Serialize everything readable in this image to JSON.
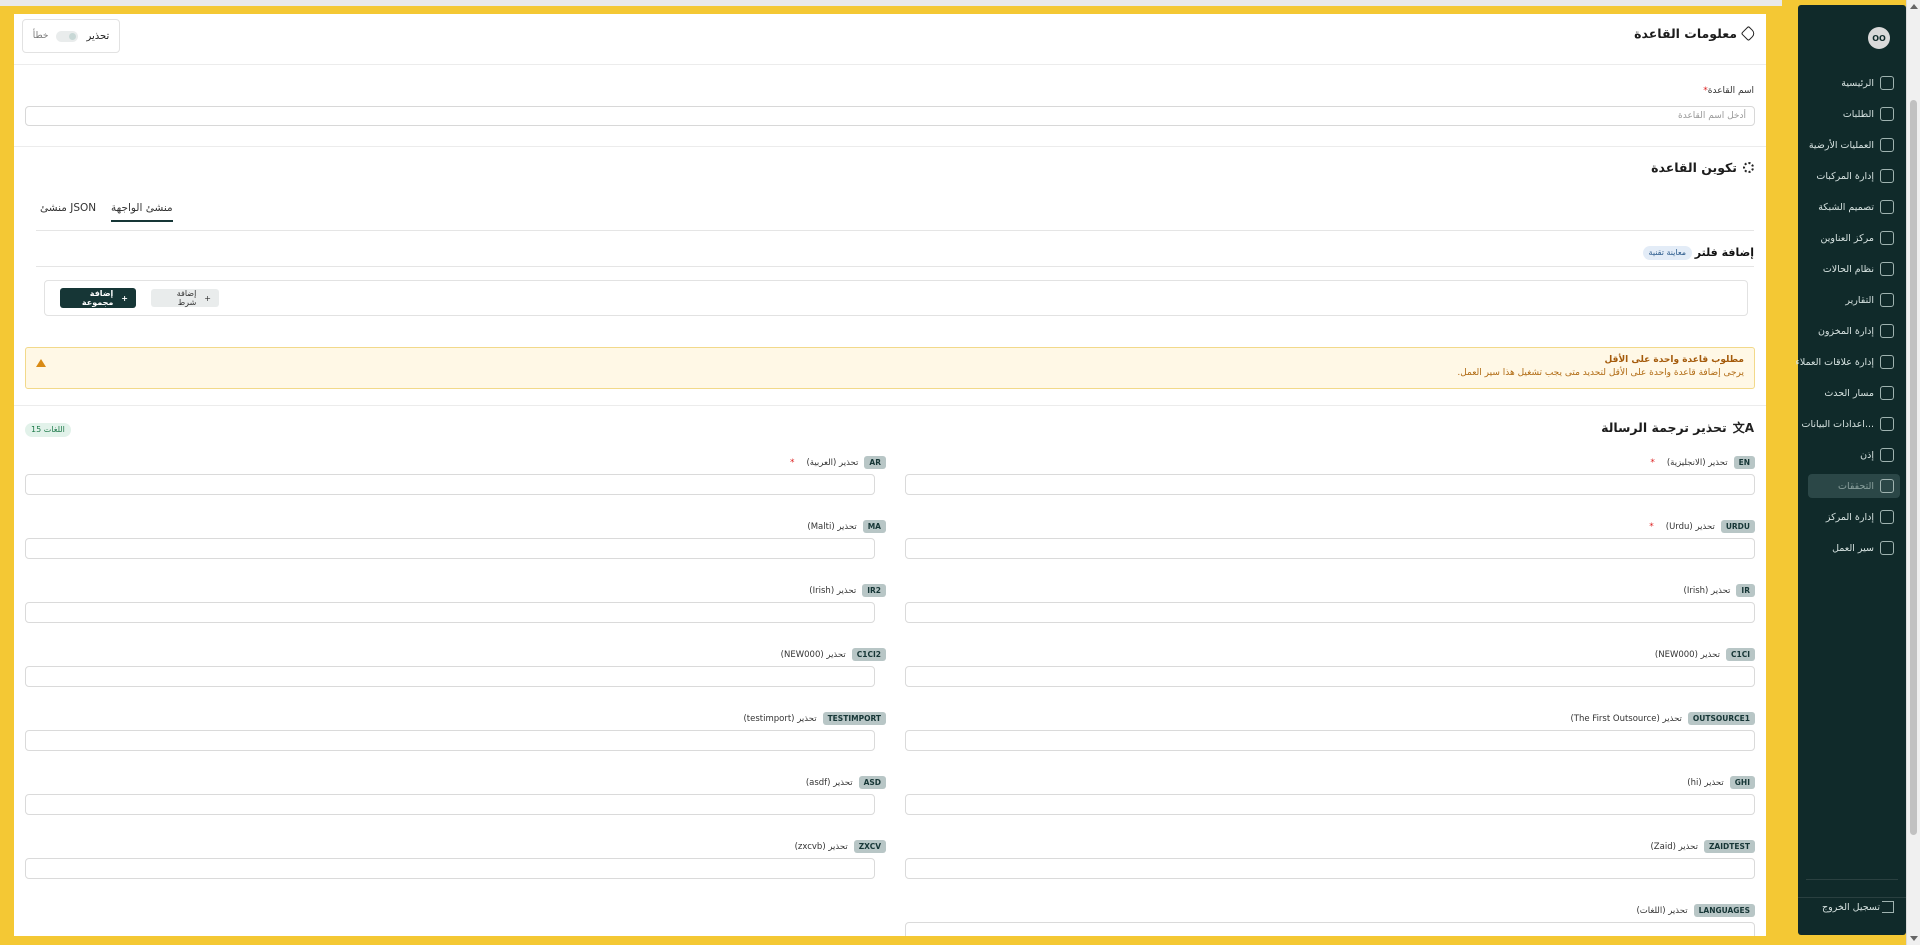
{
  "rule_info": {
    "title": "معلومات القاعدة",
    "toggle_on_label": "تحذير",
    "toggle_off_label": "خطأ"
  },
  "rule_name": {
    "label": "اسم القاعدة",
    "required_mark": "*",
    "placeholder": "أدخل اسم القاعدة"
  },
  "rule_config": {
    "title": "تكوين القاعدة",
    "tabs": [
      "منشئ الواجهة",
      "منشئ JSON"
    ],
    "active_tab": 0
  },
  "filter": {
    "title": "إضافة فلتر",
    "badge": "معاينة تقنية",
    "add_group_label": "إضافة مجموعة",
    "add_condition_label": "إضافة شرط"
  },
  "warning": {
    "title": "مطلوب قاعدة واحدة على الأقل",
    "description": "يرجى إضافة قاعدة واحدة على الأقل لتحديد متى يجب تشغيل هذا سير العمل."
  },
  "translation": {
    "title": "تحذير ترجمة الرسالة",
    "count_badge": "15 اللغات",
    "languages": [
      {
        "code": "EN",
        "label": "تحذير (الانجليزية)",
        "required": true
      },
      {
        "code": "AR",
        "label": "تحذير (العربية)",
        "required": true
      },
      {
        "code": "URDU",
        "label": "تحذير (Urdu)",
        "required": true
      },
      {
        "code": "MA",
        "label": "تحذير (Malti)",
        "required": false
      },
      {
        "code": "IR",
        "label": "تحذير (Irish)",
        "required": false
      },
      {
        "code": "IR2",
        "label": "تحذير (Irish)",
        "required": false
      },
      {
        "code": "C1CI",
        "label": "تحذير (NEW000)",
        "required": false
      },
      {
        "code": "C1CI2",
        "label": "تحذير (NEW000)",
        "required": false
      },
      {
        "code": "OUTSOURCE1",
        "label": "تحذير (The First Outsource)",
        "required": false
      },
      {
        "code": "TESTIMPORT",
        "label": "تحذير (testimport)",
        "required": false
      },
      {
        "code": "GHI",
        "label": "تحذير (hi)",
        "required": false
      },
      {
        "code": "ASD",
        "label": "تحذير (asdf)",
        "required": false
      },
      {
        "code": "ZAIDTEST",
        "label": "تحذير (Zaid)",
        "required": false
      },
      {
        "code": "ZXCV",
        "label": "تحذير (zxcvb)",
        "required": false
      },
      {
        "code": "LANGUAGES",
        "label": "تحذير (اللغات)",
        "required": false
      }
    ]
  },
  "sidebar": {
    "avatar": "OO",
    "items": [
      {
        "label": "الرئيسية",
        "icon": "dashboard-icon"
      },
      {
        "label": "الطلبات",
        "icon": "orders-icon"
      },
      {
        "label": "العمليات الأرضية",
        "icon": "ground-ops-icon"
      },
      {
        "label": "إدارة المركبات",
        "icon": "truck-icon"
      },
      {
        "label": "تصميم الشبكة",
        "icon": "network-icon"
      },
      {
        "label": "مركز العناوين",
        "icon": "address-icon"
      },
      {
        "label": "نظام الحالات",
        "icon": "status-icon"
      },
      {
        "label": "التقارير",
        "icon": "reports-icon"
      },
      {
        "label": "إدارة المخزون",
        "icon": "inventory-icon"
      },
      {
        "label": "إدارة علاقات العملاء",
        "icon": "crm-icon"
      },
      {
        "label": "مسار الحدث",
        "icon": "route-icon"
      },
      {
        "label": "اعدادات البيانات...",
        "icon": "database-icon"
      },
      {
        "label": "إذن",
        "icon": "users-icon"
      },
      {
        "label": "التحققات",
        "icon": "validations-icon",
        "active": true
      },
      {
        "label": "إدارة المركز",
        "icon": "hub-icon"
      },
      {
        "label": "سير العمل",
        "icon": "workflow-icon"
      }
    ],
    "logout_label": "تسجيل الخروج"
  }
}
